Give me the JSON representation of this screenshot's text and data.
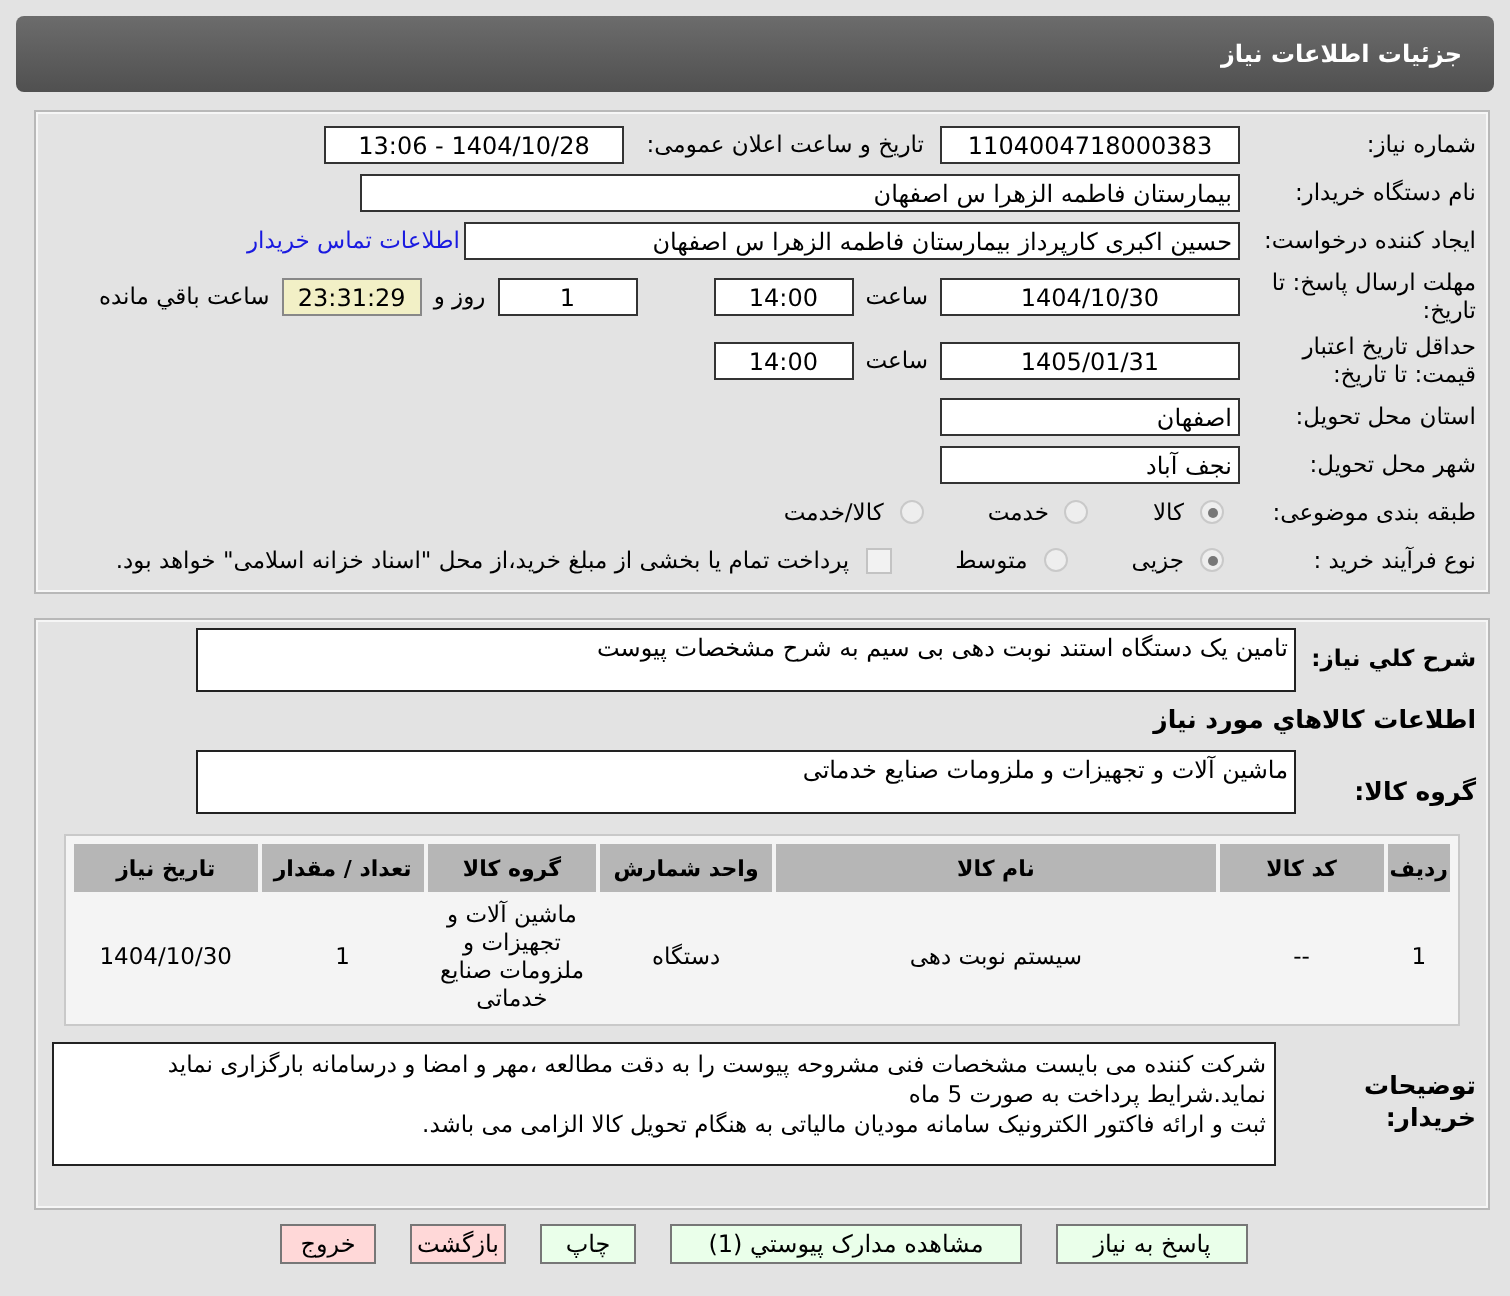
{
  "header": {
    "title": "جزئیات اطلاعات نیاز"
  },
  "fields": {
    "need_number": {
      "label": "شماره نیاز:",
      "value": "1104004718000383"
    },
    "announce": {
      "label": "تاریخ و ساعت اعلان عمومی:",
      "value": "1404/10/28 - 13:06"
    },
    "buyer": {
      "label": "نام دستگاه خریدار:",
      "value": "بیمارستان فاطمه الزهرا س  اصفهان"
    },
    "creator": {
      "label": "ایجاد کننده درخواست:",
      "value": "حسین اکبری کارپرداز بیمارستان فاطمه الزهرا س  اصفهان",
      "link": "اطلاعات تماس خریدار"
    },
    "deadline": {
      "label": "مهلت ارسال پاسخ: تا تاریخ:",
      "date": "1404/10/30",
      "time_label": "ساعت",
      "time": "14:00",
      "days": "1",
      "days_label": "روز و",
      "remaining": "23:31:29",
      "remaining_label": "ساعت باقي مانده"
    },
    "validity": {
      "label": "حداقل تاریخ اعتبار قیمت: تا تاریخ:",
      "date": "1405/01/31",
      "time_label": "ساعت",
      "time": "14:00"
    },
    "province": {
      "label": "استان محل تحویل:",
      "value": "اصفهان"
    },
    "city": {
      "label": "شهر محل تحویل:",
      "value": "نجف آباد"
    }
  },
  "category": {
    "label": "طبقه بندی موضوعی:",
    "options": [
      {
        "label": "کالا",
        "selected": true
      },
      {
        "label": "خدمت",
        "selected": false
      },
      {
        "label": "کالا/خدمت",
        "selected": false
      }
    ]
  },
  "process": {
    "label": "نوع فرآیند خرید :",
    "options": [
      {
        "label": "جزیی",
        "selected": true
      },
      {
        "label": "متوسط",
        "selected": false
      }
    ],
    "treasury": {
      "label": "پرداخت تمام یا بخشی از مبلغ خرید،از محل \"اسناد خزانه اسلامی\" خواهد بود.",
      "checked": false
    }
  },
  "description": {
    "label": "شرح کلي نياز:",
    "value": "تامین یک دستگاه استند نوبت دهی بی سیم به شرح مشخصات پیوست"
  },
  "goods_title": "اطلاعات کالاهاي مورد نياز",
  "goods_group": {
    "label": "گروه کالا:",
    "value": "ماشین آلات و تجهیزات و ملزومات صنایع خدماتی"
  },
  "table": {
    "columns": [
      "ردیف",
      "کد کالا",
      "نام کالا",
      "واحد شمارش",
      "گروه کالا",
      "تعداد / مقدار",
      "تاریخ نیاز"
    ],
    "rows": [
      [
        "1",
        "--",
        "سیستم نوبت دهی",
        "دستگاه",
        "ماشین آلات و تجهیزات و ملزومات صنایع خدماتی",
        "1",
        "1404/10/30"
      ]
    ]
  },
  "buyer_notes": {
    "label": "توضیحات خریدار:",
    "lines": [
      "شرکت کننده می بایست مشخصات فنی مشروحه پیوست را به دقت مطالعه ،مهر و امضا و درسامانه بارگزاری نماید نماید.شرایط پرداخت به صورت 5 ماه",
      "ثبت و ارائه فاکتور الکترونیک سامانه مودیان مالیاتی به هنگام تحویل کالا الزامی می باشد."
    ]
  },
  "buttons": [
    {
      "label": "پاسخ به نیاز",
      "kind": "normal"
    },
    {
      "label": "مشاهده مدارک پیوستي (1)",
      "kind": "normal"
    },
    {
      "label": "چاپ",
      "kind": "normal"
    },
    {
      "label": "بازگشت",
      "kind": "danger"
    },
    {
      "label": "خروج",
      "kind": "danger"
    }
  ]
}
